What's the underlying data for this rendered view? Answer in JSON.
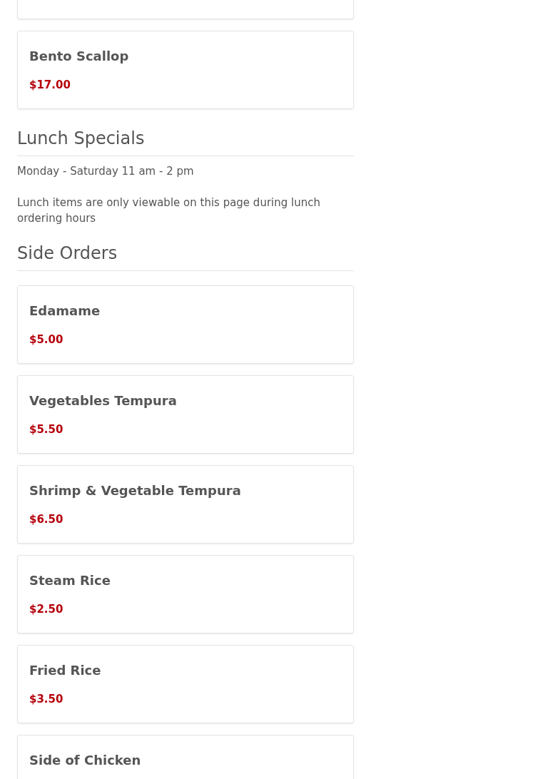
{
  "items_before": [
    {
      "name": "Bento Scallop",
      "price": "$17.00"
    }
  ],
  "sections": [
    {
      "title": "Lunch Specials",
      "notes": [
        "Monday - Saturday 11 am - 2 pm",
        "Lunch items are only viewable on this page during lunch ordering hours"
      ]
    },
    {
      "title": "Side Orders",
      "items": [
        {
          "name": "Edamame",
          "price": "$5.00"
        },
        {
          "name": "Vegetables Tempura",
          "price": "$5.50"
        },
        {
          "name": "Shrimp & Vegetable Tempura",
          "price": "$6.50"
        },
        {
          "name": "Steam Rice",
          "price": "$2.50"
        },
        {
          "name": "Fried Rice",
          "price": "$3.50"
        },
        {
          "name": "Side of Chicken"
        }
      ]
    }
  ]
}
